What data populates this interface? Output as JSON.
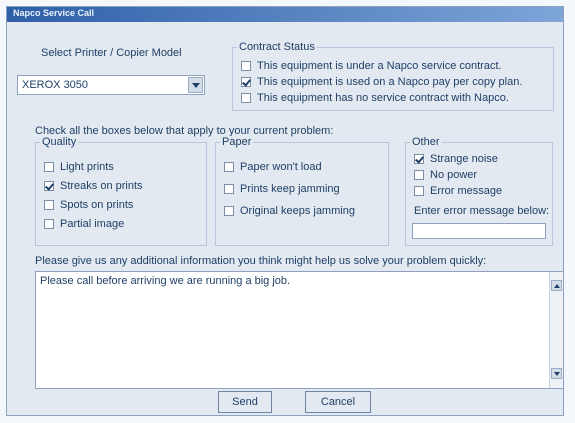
{
  "window": {
    "title": "Napco Service Call"
  },
  "model": {
    "label": "Select Printer / Copier Model",
    "selected": "XEROX 3050"
  },
  "contract": {
    "title": "Contract Status",
    "options": [
      {
        "label": "This equipment is under a Napco service contract.",
        "checked": false
      },
      {
        "label": "This equipment is used on a Napco pay per copy plan.",
        "checked": true
      },
      {
        "label": "This equipment has no service contract with Napco.",
        "checked": false
      }
    ]
  },
  "instructions": "Check all the boxes below that apply to your current problem:",
  "quality": {
    "title": "Quality",
    "options": [
      {
        "label": "Light prints",
        "checked": false
      },
      {
        "label": "Streaks on prints",
        "checked": true
      },
      {
        "label": "Spots on prints",
        "checked": false
      },
      {
        "label": "Partial image",
        "checked": false
      }
    ]
  },
  "paper": {
    "title": "Paper",
    "options": [
      {
        "label": "Paper won't load",
        "checked": false
      },
      {
        "label": "Prints keep jamming",
        "checked": false
      },
      {
        "label": "Original keeps jamming",
        "checked": false
      }
    ]
  },
  "other": {
    "title": "Other",
    "options": [
      {
        "label": "Strange noise",
        "checked": true
      },
      {
        "label": "No power",
        "checked": false
      },
      {
        "label": "Error message",
        "checked": false
      }
    ],
    "error_label": "Enter error message below:",
    "error_value": ""
  },
  "info": {
    "label": "Please give us any additional information you think might help us solve your problem quickly:",
    "text": "Please call before arriving we are running a big job."
  },
  "buttons": {
    "send": "Send",
    "cancel": "Cancel"
  },
  "icons": {
    "dropdown": "chevron-down-icon",
    "scroll_up": "scroll-up-arrow-icon",
    "scroll_down": "scroll-down-arrow-icon"
  }
}
